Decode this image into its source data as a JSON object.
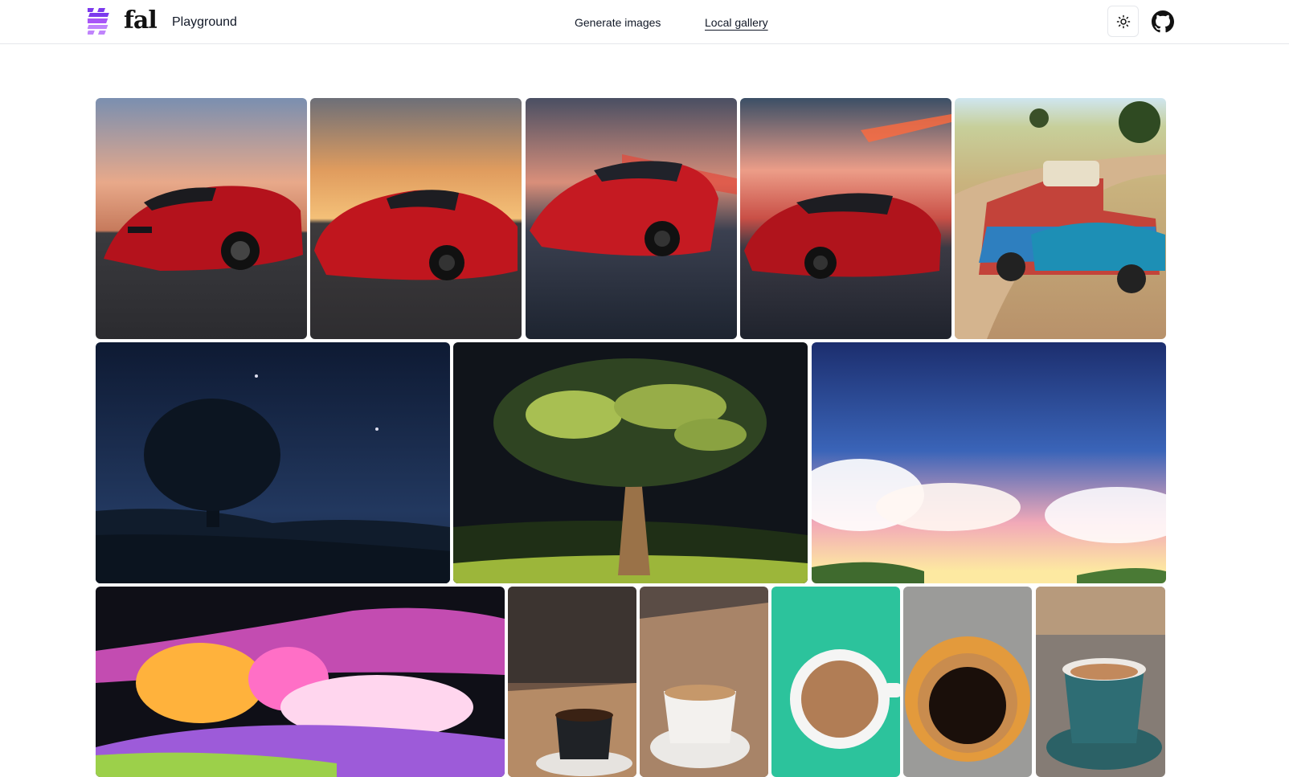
{
  "header": {
    "brand_name": "fal",
    "brand_subtitle": "Playground",
    "nav": [
      {
        "label": "Generate images",
        "active": false
      },
      {
        "label": "Local gallery",
        "active": true
      }
    ],
    "theme_toggle_icon": "sun-icon",
    "github_icon": "github-icon",
    "brand_color": "#7c3aed"
  },
  "gallery": {
    "images": [
      {
        "subject": "red sports car at sunset, striped hood"
      },
      {
        "subject": "red sports car on road with cloudy sunset"
      },
      {
        "subject": "red sports car racing with motion blur"
      },
      {
        "subject": "red race car with speed light trails"
      },
      {
        "subject": "vintage pickup truck with blue tarp on dirt road"
      },
      {
        "subject": "lone tree silhouette under night sky"
      },
      {
        "subject": "large anime style tree at night"
      },
      {
        "subject": "starry sky above pastel clouds"
      },
      {
        "subject": "colorful psychedelic landscape with pink trees"
      },
      {
        "subject": "black coffee cup on cafe table"
      },
      {
        "subject": "latte art cup on wooden table"
      },
      {
        "subject": "coffee cup on teal background"
      },
      {
        "subject": "espresso in orange cup, top view"
      },
      {
        "subject": "teal coffee cup on saucer"
      }
    ]
  }
}
